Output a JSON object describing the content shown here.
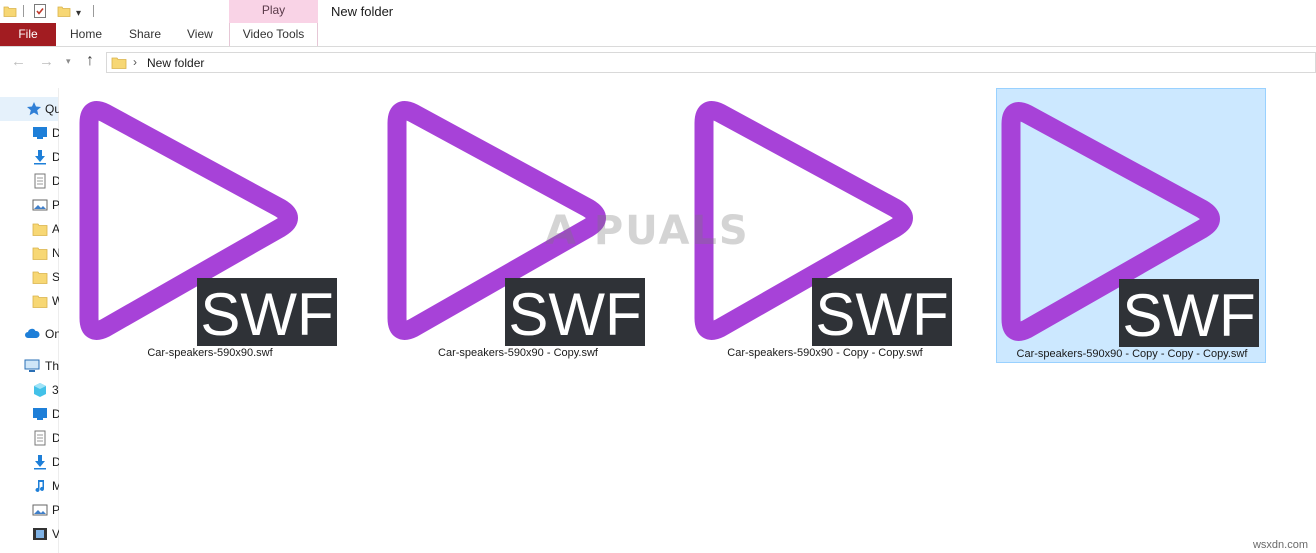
{
  "window": {
    "title": "New folder"
  },
  "ribbon": {
    "context_group_label": "Play",
    "tabs": {
      "file": "File",
      "home": "Home",
      "share": "Share",
      "view": "View",
      "video_tools": "Video Tools"
    }
  },
  "address": {
    "path": "New folder"
  },
  "colors": {
    "file_tab": "#a21c21",
    "play_context": "#f9d3e6",
    "swf_play": "#a742d8",
    "swf_badge": "#2f3237",
    "selection": "#cce8ff"
  },
  "sidebar": {
    "items": [
      {
        "label": "Qu",
        "icon": "star-icon"
      },
      {
        "label": "D",
        "icon": "desktop-icon"
      },
      {
        "label": "D",
        "icon": "download-icon"
      },
      {
        "label": "D",
        "icon": "document-icon"
      },
      {
        "label": "P",
        "icon": "pictures-icon"
      },
      {
        "label": "A",
        "icon": "folder-icon"
      },
      {
        "label": "N",
        "icon": "folder-icon"
      },
      {
        "label": "S",
        "icon": "folder-icon"
      },
      {
        "label": "W",
        "icon": "folder-icon"
      },
      {
        "label": "On",
        "icon": "cloud-icon"
      },
      {
        "label": "Th",
        "icon": "pc-icon"
      },
      {
        "label": "3",
        "icon": "cube-icon"
      },
      {
        "label": "D",
        "icon": "desktop-icon"
      },
      {
        "label": "D",
        "icon": "document-icon"
      },
      {
        "label": "D",
        "icon": "download-icon"
      },
      {
        "label": "M",
        "icon": "music-icon"
      },
      {
        "label": "P",
        "icon": "pictures-icon"
      },
      {
        "label": "V",
        "icon": "video-icon"
      }
    ]
  },
  "files": [
    {
      "name": "Car-speakers-590x90.swf",
      "badge": "SWF",
      "selected": false
    },
    {
      "name": "Car-speakers-590x90 - Copy.swf",
      "badge": "SWF",
      "selected": false
    },
    {
      "name": "Car-speakers-590x90 - Copy - Copy.swf",
      "badge": "SWF",
      "selected": false
    },
    {
      "name": "Car-speakers-590x90 - Copy - Copy - Copy.swf",
      "badge": "SWF",
      "selected": true
    }
  ],
  "watermark": "A  PUALS",
  "source": "wsxdn.com"
}
